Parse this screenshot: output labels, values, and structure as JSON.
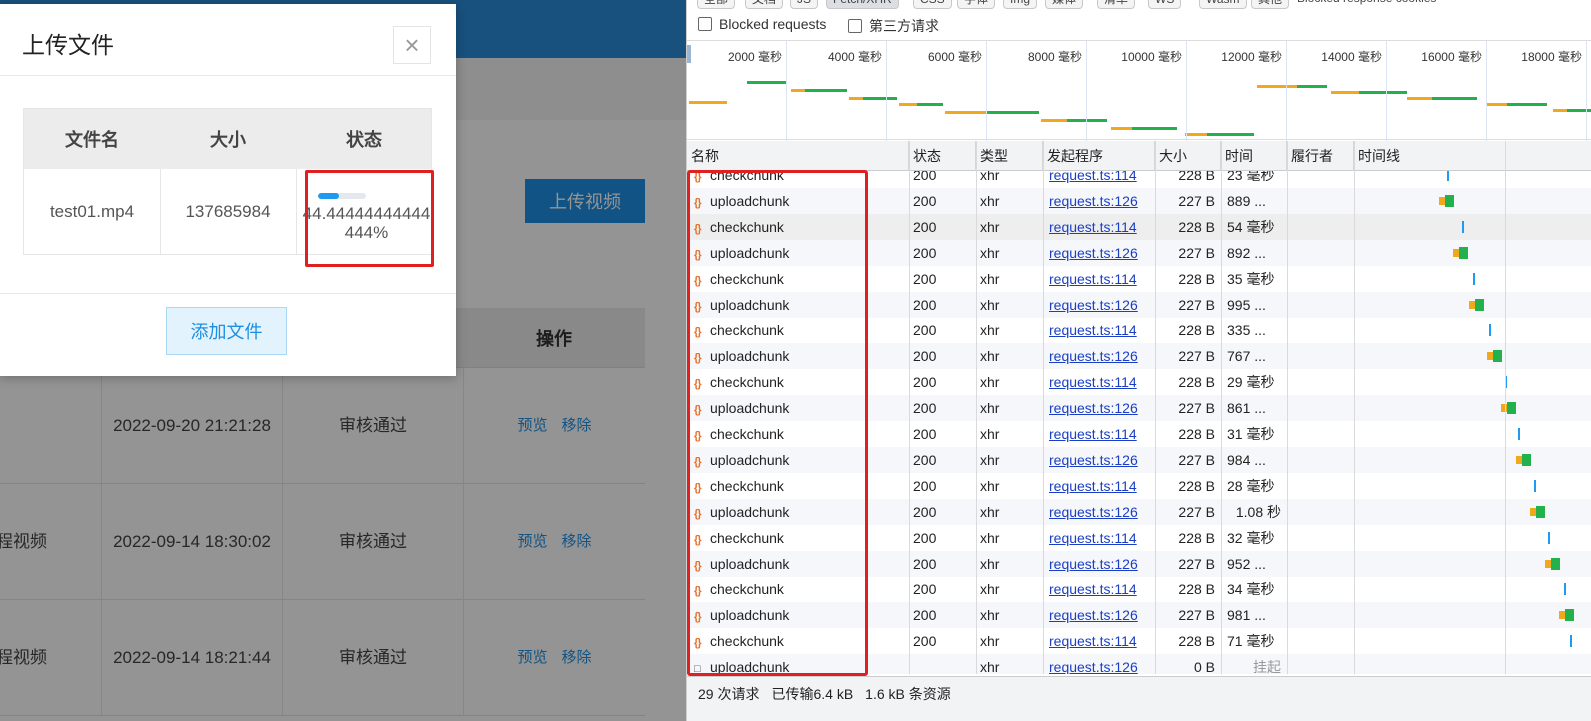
{
  "app": {
    "upload_video_label": "上传视频",
    "table_ops_header": "操作",
    "videos": [
      {
        "name": "",
        "date": "2022-09-20 21:21:28",
        "status": "审核通过",
        "preview": "预览",
        "remove": "移除"
      },
      {
        "name": "程视频",
        "date": "2022-09-14 18:30:02",
        "status": "审核通过",
        "preview": "预览",
        "remove": "移除"
      },
      {
        "name": "程视频",
        "date": "2022-09-14 18:21:44",
        "status": "审核通过",
        "preview": "预览",
        "remove": "移除"
      }
    ]
  },
  "dialog": {
    "title": "上传文件",
    "close_symbol": "×",
    "headers": {
      "name": "文件名",
      "size": "大小",
      "status": "状态"
    },
    "file": {
      "name": "test01.mp4",
      "size": "137685984",
      "progress_text": "44.44444444444444%",
      "progress_fraction": 0.444
    },
    "add_file_label": "添加文件"
  },
  "devtools": {
    "filter_chips": [
      "全部",
      "文档",
      "JS",
      "Fetch/XHR",
      "CSS",
      "字体",
      "Img",
      "媒体",
      "清单",
      "WS",
      "Wasm",
      "其他"
    ],
    "blocked_cookies_label": "Blocked response cookies",
    "blocked_requests_label": "Blocked requests",
    "third_party_label": "第三方请求",
    "timeline_ticks": [
      "2000 毫秒",
      "4000 毫秒",
      "6000 毫秒",
      "8000 毫秒",
      "10000 毫秒",
      "12000 毫秒",
      "14000 毫秒",
      "16000 毫秒",
      "18000 毫秒"
    ],
    "columns": {
      "name": "名称",
      "status": "状态",
      "type": "类型",
      "initiator": "发起程序",
      "size": "大小",
      "time": "时间",
      "fulfilled": "履行者",
      "waterfall": "时间线"
    },
    "requests": [
      {
        "name": "checkchunk",
        "status": "200",
        "type": "xhr",
        "initiator": "request.ts:114",
        "size": "228 B",
        "time": "23 毫秒"
      },
      {
        "name": "uploadchunk",
        "status": "200",
        "type": "xhr",
        "initiator": "request.ts:126",
        "size": "227 B",
        "time": "889 ..."
      },
      {
        "name": "checkchunk",
        "status": "200",
        "type": "xhr",
        "initiator": "request.ts:114",
        "size": "228 B",
        "time": "54 毫秒"
      },
      {
        "name": "uploadchunk",
        "status": "200",
        "type": "xhr",
        "initiator": "request.ts:126",
        "size": "227 B",
        "time": "892 ..."
      },
      {
        "name": "checkchunk",
        "status": "200",
        "type": "xhr",
        "initiator": "request.ts:114",
        "size": "228 B",
        "time": "35 毫秒"
      },
      {
        "name": "uploadchunk",
        "status": "200",
        "type": "xhr",
        "initiator": "request.ts:126",
        "size": "227 B",
        "time": "995 ..."
      },
      {
        "name": "checkchunk",
        "status": "200",
        "type": "xhr",
        "initiator": "request.ts:114",
        "size": "228 B",
        "time": "335 ..."
      },
      {
        "name": "uploadchunk",
        "status": "200",
        "type": "xhr",
        "initiator": "request.ts:126",
        "size": "227 B",
        "time": "767 ..."
      },
      {
        "name": "checkchunk",
        "status": "200",
        "type": "xhr",
        "initiator": "request.ts:114",
        "size": "228 B",
        "time": "29 毫秒"
      },
      {
        "name": "uploadchunk",
        "status": "200",
        "type": "xhr",
        "initiator": "request.ts:126",
        "size": "227 B",
        "time": "861 ..."
      },
      {
        "name": "checkchunk",
        "status": "200",
        "type": "xhr",
        "initiator": "request.ts:114",
        "size": "228 B",
        "time": "31 毫秒"
      },
      {
        "name": "uploadchunk",
        "status": "200",
        "type": "xhr",
        "initiator": "request.ts:126",
        "size": "227 B",
        "time": "984 ..."
      },
      {
        "name": "checkchunk",
        "status": "200",
        "type": "xhr",
        "initiator": "request.ts:114",
        "size": "228 B",
        "time": "28 毫秒"
      },
      {
        "name": "uploadchunk",
        "status": "200",
        "type": "xhr",
        "initiator": "request.ts:126",
        "size": "227 B",
        "time": "1.08 秒"
      },
      {
        "name": "checkchunk",
        "status": "200",
        "type": "xhr",
        "initiator": "request.ts:114",
        "size": "228 B",
        "time": "32 毫秒"
      },
      {
        "name": "uploadchunk",
        "status": "200",
        "type": "xhr",
        "initiator": "request.ts:126",
        "size": "227 B",
        "time": "952 ..."
      },
      {
        "name": "checkchunk",
        "status": "200",
        "type": "xhr",
        "initiator": "request.ts:114",
        "size": "228 B",
        "time": "34 毫秒"
      },
      {
        "name": "uploadchunk",
        "status": "200",
        "type": "xhr",
        "initiator": "request.ts:126",
        "size": "227 B",
        "time": "981 ..."
      },
      {
        "name": "checkchunk",
        "status": "200",
        "type": "xhr",
        "initiator": "request.ts:114",
        "size": "228 B",
        "time": "71 毫秒"
      },
      {
        "name": "uploadchunk",
        "status": "",
        "type": "xhr",
        "initiator": "request.ts:126",
        "size": "0 B",
        "time": "挂起",
        "pending": true
      }
    ],
    "summary": {
      "requests": "29 次请求",
      "transferred": "已传输6.4 kB",
      "resources": "1.6 kB 条资源"
    },
    "colors": {
      "waiting": "#f0a81d",
      "download": "#22b14c",
      "request_icon": "#e8702a",
      "link": "#1a3ec4",
      "highlight": "#e02020"
    }
  }
}
